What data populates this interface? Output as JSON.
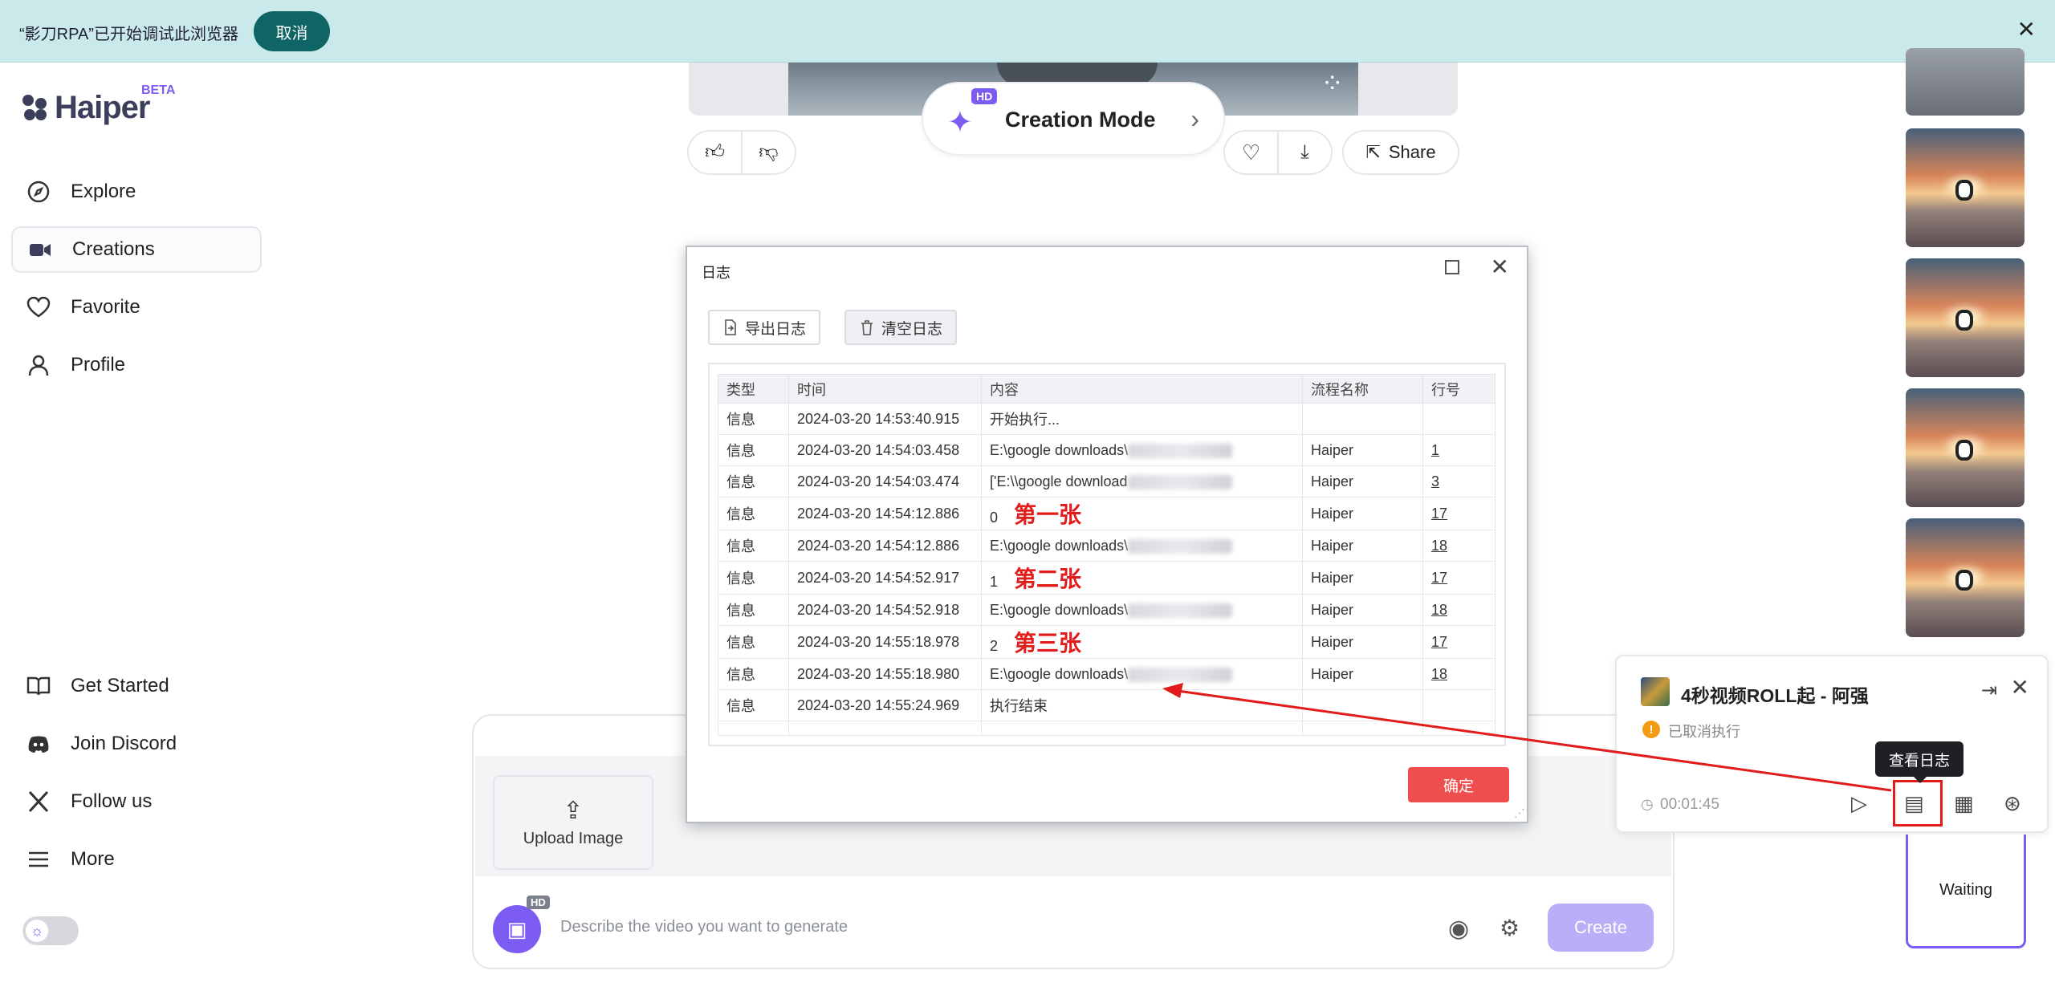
{
  "notification": {
    "message": "“影刀RPA”已开始调试此浏览器",
    "cancel_label": "取消",
    "close_icon": "close-icon"
  },
  "brand": {
    "name": "Haiper",
    "badge": "BETA"
  },
  "sidebar": {
    "items": [
      {
        "label": "Explore",
        "icon": "compass-icon"
      },
      {
        "label": "Creations",
        "icon": "video-camera-icon",
        "active": true
      },
      {
        "label": "Favorite",
        "icon": "heart-icon"
      },
      {
        "label": "Profile",
        "icon": "person-icon"
      }
    ],
    "bottom_items": [
      {
        "label": "Get Started",
        "icon": "book-icon"
      },
      {
        "label": "Join Discord",
        "icon": "discord-icon"
      },
      {
        "label": "Follow us",
        "icon": "x-logo-icon"
      },
      {
        "label": "More",
        "icon": "menu-icon"
      }
    ]
  },
  "video_actions": {
    "share_label": "Share"
  },
  "creation_mode": {
    "label": "Creation Mode",
    "badge": "HD"
  },
  "prompt": {
    "upload_label": "Upload Image",
    "image_badge": "HD",
    "placeholder": "Describe the video you want to generate",
    "create_label": "Create"
  },
  "log_dialog": {
    "title": "日志",
    "export_label": "导出日志",
    "clear_label": "清空日志",
    "ok_label": "确定",
    "columns": [
      "类型",
      "时间",
      "内容",
      "流程名称",
      "行号"
    ],
    "rows": [
      {
        "type": "信息",
        "time": "2024-03-20 14:53:40.915",
        "content": "开始执行...",
        "annotation": "",
        "process": "",
        "line": ""
      },
      {
        "type": "信息",
        "time": "2024-03-20 14:54:03.458",
        "content": "E:\\google downloads\\",
        "annotation": "",
        "process": "Haiper",
        "line": "1"
      },
      {
        "type": "信息",
        "time": "2024-03-20 14:54:03.474",
        "content": "['E:\\\\google download",
        "annotation": "",
        "process": "Haiper",
        "line": "3"
      },
      {
        "type": "信息",
        "time": "2024-03-20 14:54:12.886",
        "content": "0",
        "annotation": "第一张",
        "process": "Haiper",
        "line": "17"
      },
      {
        "type": "信息",
        "time": "2024-03-20 14:54:12.886",
        "content": "E:\\google downloads\\",
        "annotation": "",
        "process": "Haiper",
        "line": "18"
      },
      {
        "type": "信息",
        "time": "2024-03-20 14:54:52.917",
        "content": "1",
        "annotation": "第二张",
        "process": "Haiper",
        "line": "17"
      },
      {
        "type": "信息",
        "time": "2024-03-20 14:54:52.918",
        "content": "E:\\google downloads\\",
        "annotation": "",
        "process": "Haiper",
        "line": "18"
      },
      {
        "type": "信息",
        "time": "2024-03-20 14:55:18.978",
        "content": "2",
        "annotation": "第三张",
        "process": "Haiper",
        "line": "17"
      },
      {
        "type": "信息",
        "time": "2024-03-20 14:55:18.980",
        "content": "E:\\google downloads\\",
        "annotation": "",
        "process": "Haiper",
        "line": "18"
      },
      {
        "type": "信息",
        "time": "2024-03-20 14:55:24.969",
        "content": "执行结束",
        "annotation": "",
        "process": "",
        "line": ""
      }
    ]
  },
  "rpa_panel": {
    "title": "4秒视频ROLL起 - 阿强",
    "status": "已取消执行",
    "elapsed": "00:01:45",
    "tooltip": "查看日志"
  },
  "queue": {
    "waiting_label": "Waiting"
  },
  "colors": {
    "accent": "#7c5cf2",
    "notify_bg": "#c9e9ea",
    "cancel_bg": "#0f6466",
    "ok_red": "#ef4e4e",
    "annotation_red": "#e21b1b"
  }
}
